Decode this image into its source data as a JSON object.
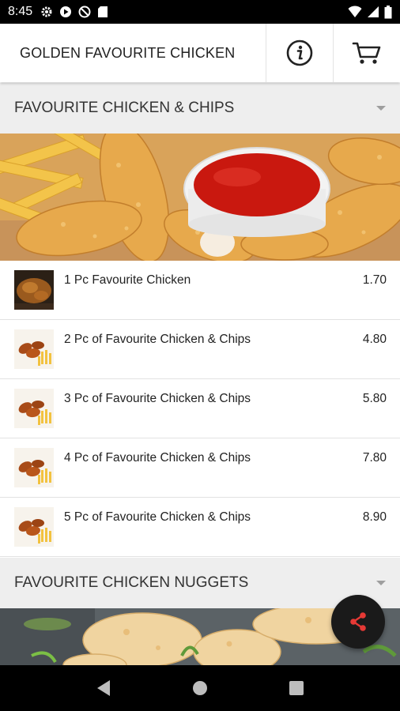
{
  "status_bar": {
    "time": "8:45",
    "left_icons": [
      "gear-icon",
      "play-store-icon",
      "no-sync-icon",
      "sd-card-icon"
    ],
    "right_icons": [
      "wifi-icon",
      "signal-icon",
      "battery-icon"
    ]
  },
  "app_bar": {
    "title": "GOLDEN FAVOURITE CHICKEN",
    "info_icon": "info-icon",
    "cart_icon": "cart-icon"
  },
  "sections": [
    {
      "title": "FAVOURITE CHICKEN & CHIPS",
      "items": [
        {
          "name": "1 Pc Favourite Chicken",
          "price": "1.70",
          "thumb": "fried-chicken-piece"
        },
        {
          "name": "2 Pc of Favourite Chicken & Chips",
          "price": "4.80",
          "thumb": "wings-and-fries"
        },
        {
          "name": "3 Pc of Favourite Chicken & Chips",
          "price": "5.80",
          "thumb": "wings-and-fries"
        },
        {
          "name": "4 Pc of Favourite Chicken & Chips",
          "price": "7.80",
          "thumb": "wings-and-fries"
        },
        {
          "name": "5 Pc of Favourite Chicken & Chips",
          "price": "8.90",
          "thumb": "wings-and-fries"
        }
      ]
    },
    {
      "title": "FAVOURITE CHICKEN NUGGETS",
      "items": []
    }
  ],
  "fab": {
    "icon": "share-icon",
    "icon_color": "#e53935"
  },
  "nav_bar": {
    "buttons": [
      "back-icon",
      "home-icon",
      "recents-icon"
    ]
  },
  "colors": {
    "section_bg": "#eeeeee",
    "fab_bg": "#1a1a1a",
    "accent": "#e53935"
  }
}
